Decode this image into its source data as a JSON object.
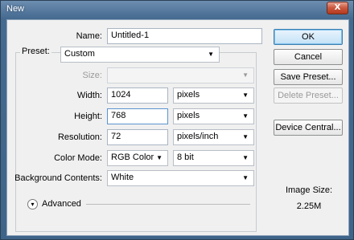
{
  "window": {
    "title": "New",
    "close_glyph": "X"
  },
  "name": {
    "label": "Name:",
    "value": "Untitled-1"
  },
  "preset": {
    "label": "Preset:",
    "value": "Custom"
  },
  "size": {
    "label": "Size:",
    "value": ""
  },
  "width": {
    "label": "Width:",
    "value": "1024",
    "unit": "pixels"
  },
  "height": {
    "label": "Height:",
    "value": "768",
    "unit": "pixels"
  },
  "resolution": {
    "label": "Resolution:",
    "value": "72",
    "unit": "pixels/inch"
  },
  "color_mode": {
    "label": "Color Mode:",
    "value": "RGB Color",
    "bits": "8 bit"
  },
  "background": {
    "label": "Background Contents:",
    "value": "White"
  },
  "advanced": {
    "label": "Advanced"
  },
  "buttons": {
    "ok": "OK",
    "cancel": "Cancel",
    "save_preset": "Save Preset...",
    "delete_preset": "Delete Preset...",
    "device_central": "Device Central..."
  },
  "image_size": {
    "label": "Image Size:",
    "value": "2.25M"
  },
  "icons": {
    "dropdown": "chevron-down-icon",
    "advanced": "expand-circle-icon",
    "close": "close-icon"
  }
}
